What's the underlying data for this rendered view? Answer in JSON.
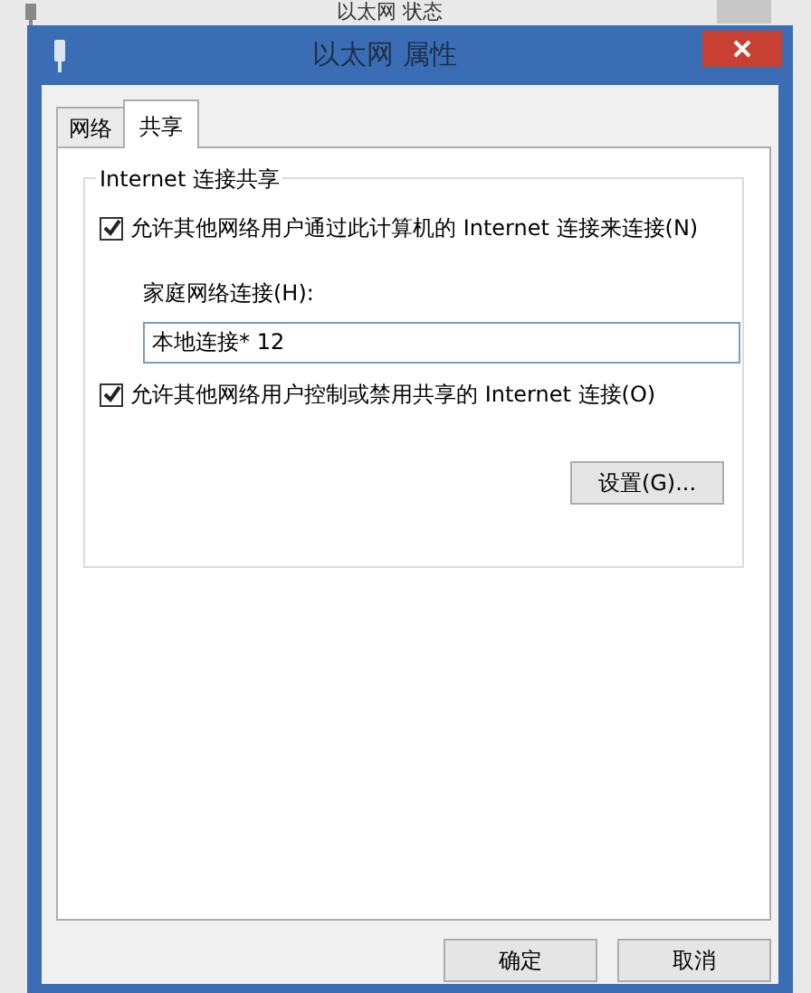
{
  "background_window": {
    "title": "以太网 状态"
  },
  "window": {
    "title": "以太网 属性"
  },
  "tabs": [
    {
      "label": "网络",
      "selected": false
    },
    {
      "label": "共享",
      "selected": true
    }
  ],
  "group": {
    "title": "Internet 连接共享"
  },
  "options": [
    {
      "kind": "checkbox",
      "label": "允许其他网络用户通过此计算机的 Internet 连接来连接(N)",
      "checked": true
    },
    {
      "kind": "field",
      "label": "家庭网络连接(H):",
      "value": "本地连接* 12"
    },
    {
      "kind": "checkbox",
      "label": "允许其他网络用户控制或禁用共享的 Internet 连接(O)",
      "checked": true
    }
  ],
  "settings_button": "设置(G)...",
  "buttons": [
    "确定",
    "取消"
  ]
}
